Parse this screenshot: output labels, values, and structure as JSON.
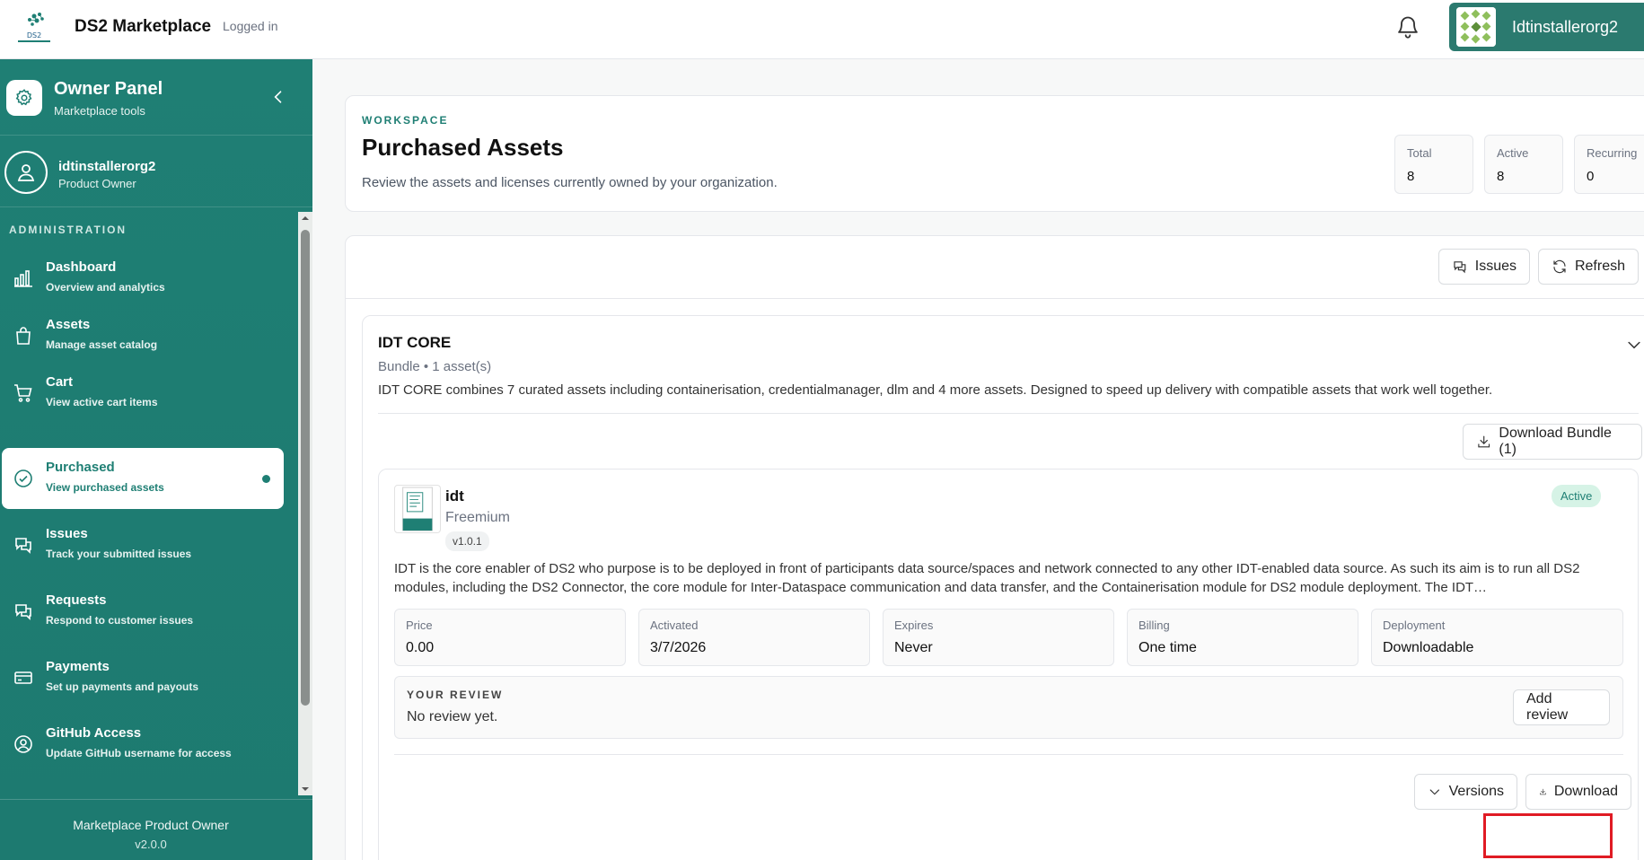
{
  "app": {
    "brand": "DS2 Marketplace",
    "status": "Logged in",
    "logo_text": "DS2"
  },
  "header": {
    "user": "Idtinstallerorg2"
  },
  "sidebar": {
    "panel_title": "Owner Panel",
    "panel_subtitle": "Marketplace tools",
    "profile_name": "idtinstallerorg2",
    "profile_role": "Product Owner",
    "section_label": "ADMINISTRATION",
    "items": [
      {
        "title": "Dashboard",
        "subtitle": "Overview and analytics",
        "icon": "bar-chart-icon"
      },
      {
        "title": "Assets",
        "subtitle": "Manage asset catalog",
        "icon": "shopping-bag-icon"
      },
      {
        "title": "Cart",
        "subtitle": "View active cart items",
        "icon": "cart-icon"
      },
      {
        "title": "Purchased",
        "subtitle": "View purchased assets",
        "icon": "check-circle-icon",
        "active": true
      },
      {
        "title": "Issues",
        "subtitle": "Track your submitted issues",
        "icon": "chat-icon"
      },
      {
        "title": "Requests",
        "subtitle": "Respond to customer issues",
        "icon": "chat-icon"
      },
      {
        "title": "Payments",
        "subtitle": "Set up payments and payouts",
        "icon": "credit-card-icon"
      },
      {
        "title": "GitHub Access",
        "subtitle": "Update GitHub username for access",
        "icon": "user-circle-icon"
      }
    ],
    "footer_role": "Marketplace Product Owner",
    "footer_version": "v2.0.0"
  },
  "workspace": {
    "kicker": "WORKSPACE",
    "title": "Purchased Assets",
    "description": "Review the assets and licenses currently owned by your organization.",
    "stats": [
      {
        "label": "Total",
        "value": "8"
      },
      {
        "label": "Active",
        "value": "8"
      },
      {
        "label": "Recurring",
        "value": "0"
      }
    ]
  },
  "toolbar": {
    "issues_label": "Issues",
    "refresh_label": "Refresh"
  },
  "bundle": {
    "title": "IDT CORE",
    "meta": "Bundle • 1 asset(s)",
    "description": "IDT CORE combines 7 curated assets including containerisation, credentialmanager, dlm and 4 more assets. Designed to speed up delivery with compatible assets that work well together.",
    "download_label": "Download Bundle (1)"
  },
  "asset": {
    "name": "idt",
    "tier": "Freemium",
    "version": "v1.0.1",
    "status": "Active",
    "description": "IDT is the core enabler of DS2 who purpose is to be deployed in front of participants data source/spaces and network connected to any other IDT-enabled data source. As such its aim is to run all DS2 modules, including the DS2 Connector, the core module for Inter-Dataspace communication and data transfer, and the Containerisation module for DS2 module deployment. The IDT…",
    "info": [
      {
        "label": "Price",
        "value": "0.00"
      },
      {
        "label": "Activated",
        "value": "3/7/2026"
      },
      {
        "label": "Expires",
        "value": "Never"
      },
      {
        "label": "Billing",
        "value": "One time"
      },
      {
        "label": "Deployment",
        "value": "Downloadable"
      }
    ],
    "review_label": "YOUR REVIEW",
    "review_value": "No review yet.",
    "add_review_label": "Add review",
    "versions_label": "Versions",
    "download_label": "Download"
  }
}
